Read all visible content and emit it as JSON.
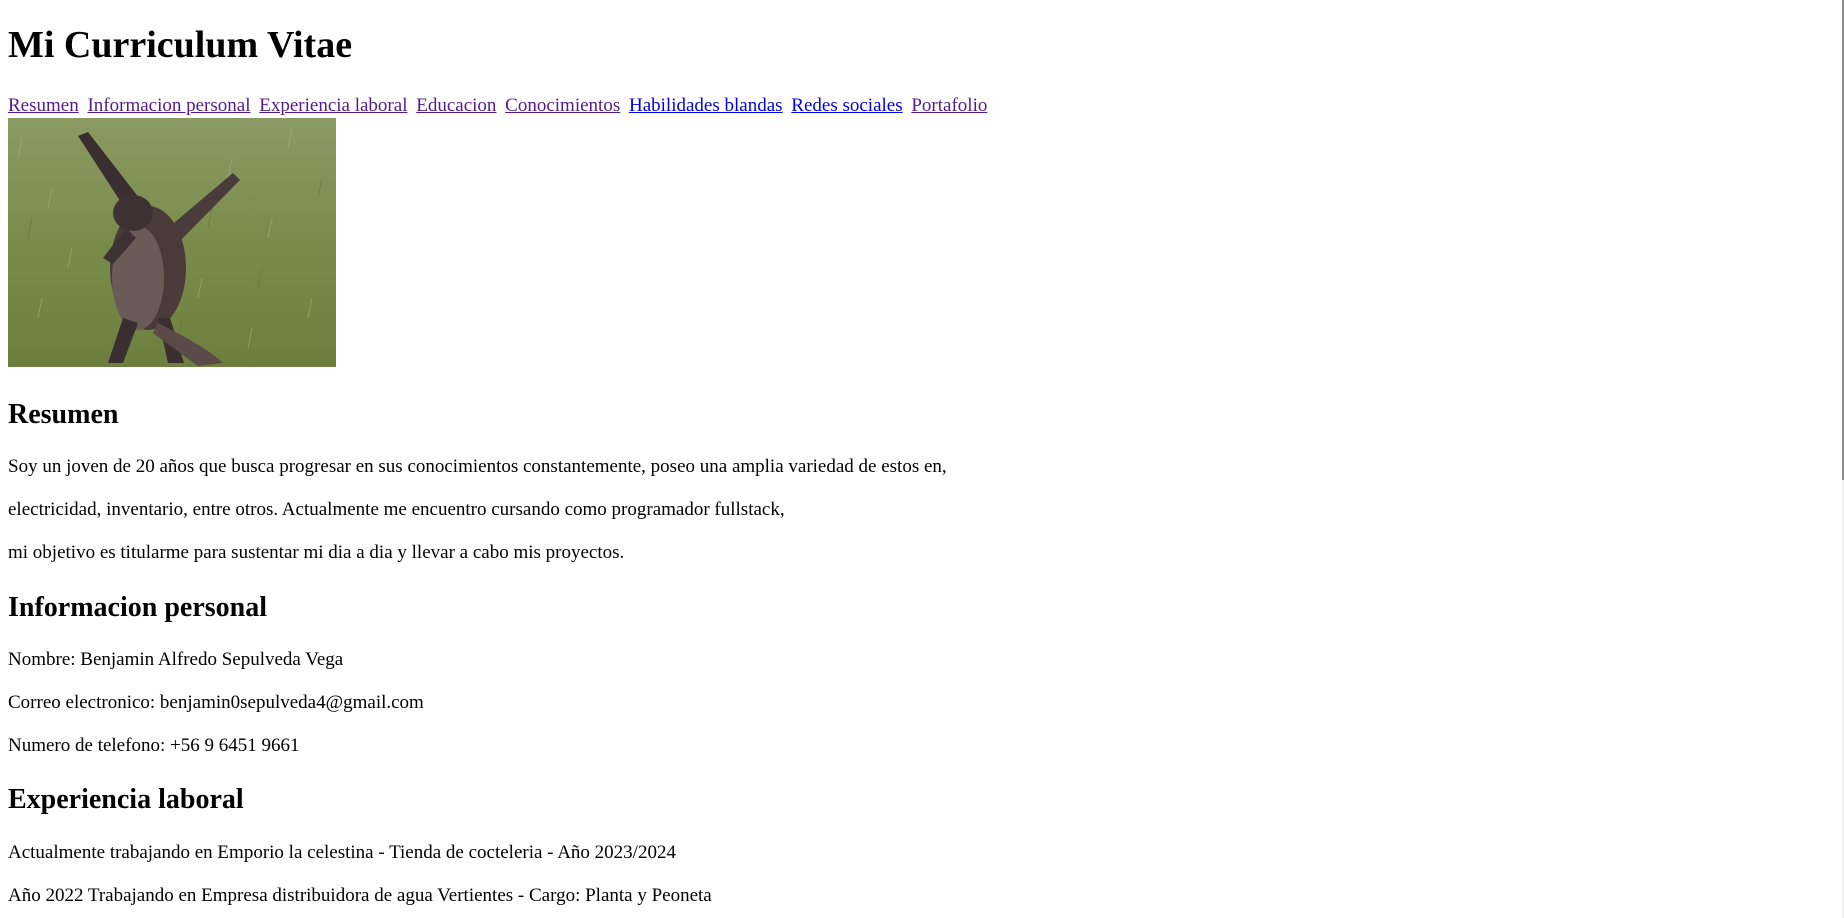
{
  "header": {
    "title": "Mi Curriculum Vitae"
  },
  "nav": {
    "items": [
      {
        "label": "Resumen"
      },
      {
        "label": "Informacion personal"
      },
      {
        "label": "Experiencia laboral"
      },
      {
        "label": "Educacion"
      },
      {
        "label": "Conocimientos"
      },
      {
        "label": "Habilidades blandas"
      },
      {
        "label": "Redes sociales"
      },
      {
        "label": "Portafolio"
      }
    ]
  },
  "colors": {
    "visited_link": "#551a8b",
    "unvisited_link": "#0000ee"
  },
  "resumen": {
    "heading": "Resumen",
    "lines": [
      "Soy un joven de 20 años que busca progresar en sus conocimientos constantemente, poseo una amplia variedad de estos en,",
      "electricidad, inventario, entre otros. Actualmente me encuentro cursando como programador fullstack,",
      "mi objetivo es titularme para sustentar mi dia a dia y llevar a cabo mis proyectos."
    ]
  },
  "info_personal": {
    "heading": "Informacion personal",
    "nombre": "Nombre: Benjamin Alfredo Sepulveda Vega",
    "correo": "Correo electronico: benjamin0sepulveda4@gmail.com",
    "telefono": "Numero de telefono: +56 9 6451 9661"
  },
  "experiencia": {
    "heading": "Experiencia laboral",
    "items": [
      "Actualmente trabajando en Emporio la celestina - Tienda de cocteleria - Año 2023/2024",
      "Año 2022 Trabajando en Empresa distribuidora de agua Vertientes - Cargo: Planta y Peoneta"
    ]
  }
}
